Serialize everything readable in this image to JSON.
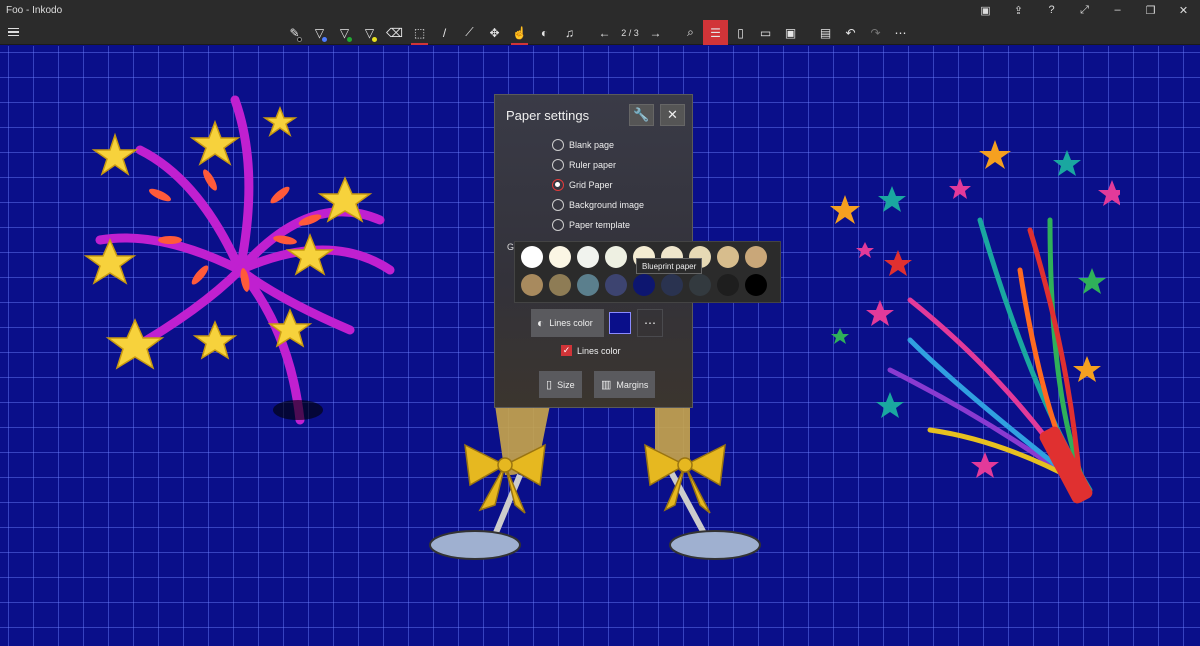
{
  "window": {
    "title": "Foo - Inkodo"
  },
  "toolbar": {
    "page_indicator": "2 / 3"
  },
  "paper_settings": {
    "title": "Paper settings",
    "options": [
      {
        "label": "Blank page",
        "checked": false
      },
      {
        "label": "Ruler paper",
        "checked": false
      },
      {
        "label": "Grid Paper",
        "checked": true
      },
      {
        "label": "Background image",
        "checked": false
      },
      {
        "label": "Paper template",
        "checked": false
      }
    ],
    "hidden_label_fragment": "G",
    "lines_color_button": "Lines color",
    "lines_color_checkbox": "Lines color",
    "size_button": "Size",
    "margins_button": "Margins"
  },
  "palette": {
    "tooltip": "Blueprint paper",
    "colors": [
      "#ffffff",
      "#fbf6e4",
      "#f1f3ee",
      "#eef0e2",
      "#f4ecd2",
      "#efe6cc",
      "#e6d9b5",
      "#d7bd8d",
      "#c9a779",
      "#a88a5e",
      "#8e7c55",
      "#5b7f8d",
      "#3d4470",
      "#0d1670",
      "#2a3350",
      "#333a3f",
      "#1e1e1e",
      "#000000"
    ],
    "accent": "#d13438",
    "grid_color": "#0a0f8a"
  }
}
